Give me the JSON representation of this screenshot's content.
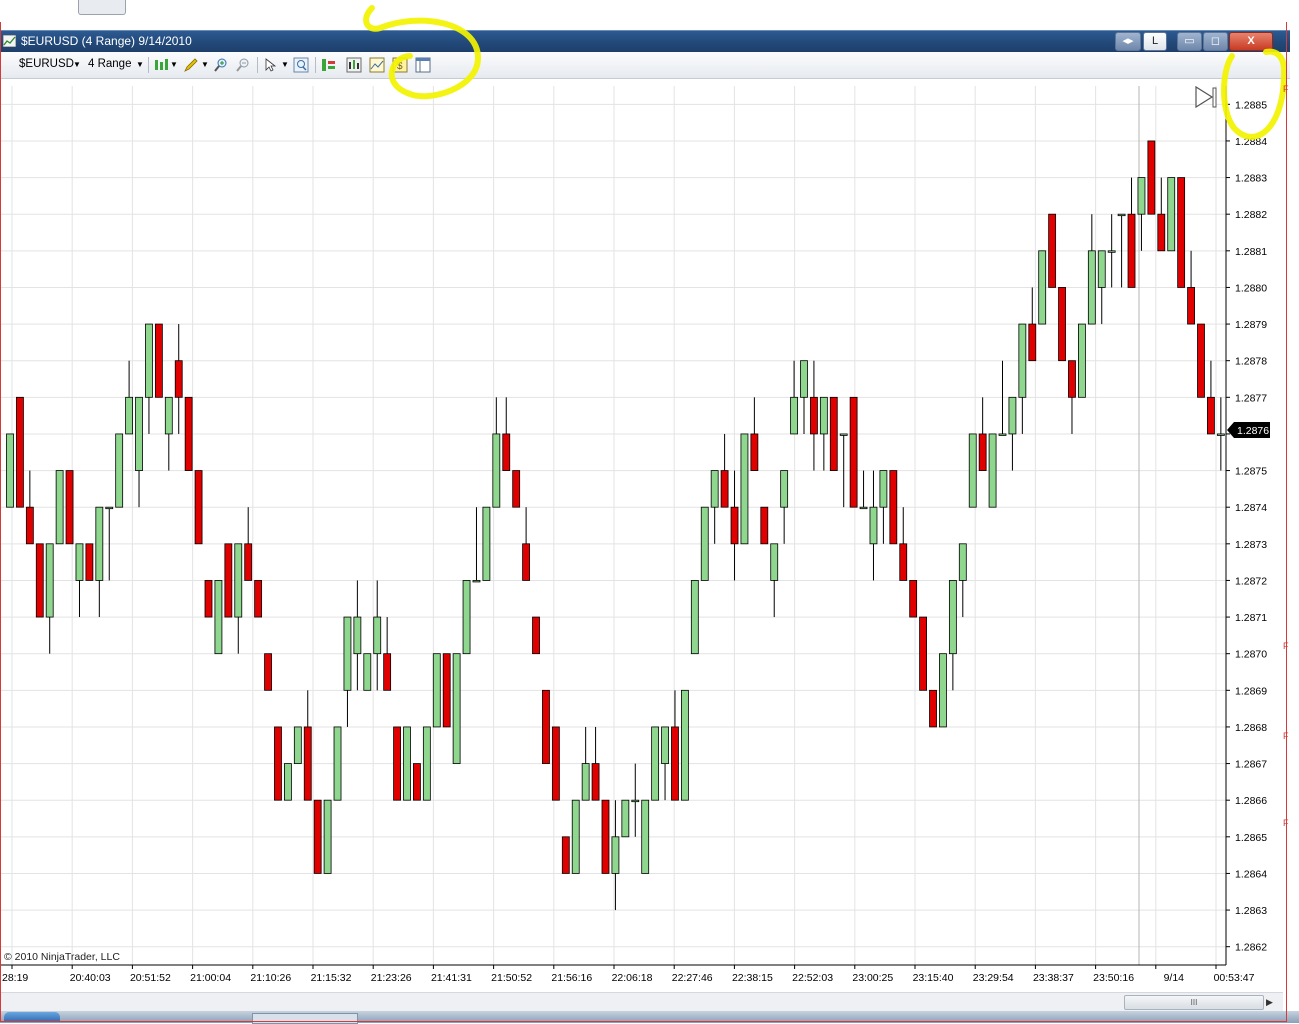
{
  "window": {
    "title": "$EURUSD (4 Range)  9/14/2010",
    "buttons": {
      "link": "L",
      "minimize": "▭",
      "maximize": "◻",
      "close": "X"
    }
  },
  "toolbar": {
    "instrument": "$EURUSD",
    "interval": "4 Range",
    "icons": [
      "bar-style-icon",
      "drawing-pencil-icon",
      "zoom-in-icon",
      "zoom-out-icon",
      "cursor-icon",
      "magnifier-icon",
      "chart-trader-icon",
      "indicators-icon",
      "strategies-icon",
      "properties-icon",
      "data-box-icon"
    ]
  },
  "colors": {
    "up_candle": "#8fd68f",
    "down_candle": "#e00000",
    "grid": "#e3e3e3",
    "highlight": "#f3f300",
    "price_marker_bg": "#000000"
  },
  "copyright": "© 2010 NinjaTrader, LLC",
  "scrollbar": {
    "thumb_label": "III"
  },
  "chart_data": {
    "type": "candlestick",
    "y_ticks": [
      "1.2885",
      "1.2884",
      "1.2883",
      "1.2882",
      "1.2881",
      "1.2880",
      "1.2879",
      "1.2878",
      "1.2877",
      "1.2876",
      "1.2875",
      "1.2874",
      "1.2873",
      "1.2872",
      "1.2871",
      "1.2870",
      "1.2869",
      "1.2868",
      "1.2867",
      "1.2866",
      "1.2865",
      "1.2864",
      "1.2863",
      "1.2862"
    ],
    "ylim": [
      1.28615,
      1.28855
    ],
    "current_price": "1.2876",
    "x_tick_labels": [
      "28:19",
      "20:40:03",
      "20:51:52",
      "21:00:04",
      "21:10:26",
      "21:15:32",
      "21:23:26",
      "21:41:31",
      "21:50:52",
      "21:56:16",
      "22:06:18",
      "22:27:46",
      "22:38:15",
      "22:52:03",
      "23:00:25",
      "23:15:40",
      "23:29:54",
      "23:38:37",
      "23:50:16",
      "9/14",
      "00:53:47"
    ],
    "candles": [
      [
        1.2874,
        1.2876,
        1.2874,
        1.2876
      ],
      [
        1.2877,
        1.2877,
        1.2874,
        1.2874
      ],
      [
        1.2874,
        1.2875,
        1.2873,
        1.2873
      ],
      [
        1.2873,
        1.2873,
        1.2871,
        1.2871
      ],
      [
        1.2871,
        1.2873,
        1.287,
        1.2873
      ],
      [
        1.2873,
        1.2875,
        1.2873,
        1.2875
      ],
      [
        1.2875,
        1.2875,
        1.2873,
        1.2873
      ],
      [
        1.2872,
        1.2873,
        1.2871,
        1.2873
      ],
      [
        1.2873,
        1.2873,
        1.2872,
        1.2872
      ],
      [
        1.2872,
        1.2874,
        1.2871,
        1.2874
      ],
      [
        1.2874,
        1.2874,
        1.2872,
        1.2874
      ],
      [
        1.2874,
        1.2876,
        1.2874,
        1.2876
      ],
      [
        1.2876,
        1.2878,
        1.2876,
        1.2877
      ],
      [
        1.2875,
        1.2877,
        1.2874,
        1.2877
      ],
      [
        1.2877,
        1.2879,
        1.2876,
        1.2879
      ],
      [
        1.2879,
        1.2879,
        1.2877,
        1.2877
      ],
      [
        1.2876,
        1.2877,
        1.2875,
        1.2877
      ],
      [
        1.2878,
        1.2879,
        1.2876,
        1.2877
      ],
      [
        1.2877,
        1.2877,
        1.2875,
        1.2875
      ],
      [
        1.2875,
        1.2875,
        1.2873,
        1.2873
      ],
      [
        1.2872,
        1.2872,
        1.2871,
        1.2871
      ],
      [
        1.287,
        1.2872,
        1.287,
        1.2872
      ],
      [
        1.2873,
        1.2873,
        1.2871,
        1.2871
      ],
      [
        1.2871,
        1.2873,
        1.287,
        1.2873
      ],
      [
        1.2873,
        1.2874,
        1.2872,
        1.2872
      ],
      [
        1.2872,
        1.2872,
        1.2871,
        1.2871
      ],
      [
        1.287,
        1.287,
        1.2869,
        1.2869
      ],
      [
        1.2868,
        1.2868,
        1.2867,
        1.2866
      ],
      [
        1.2866,
        1.2867,
        1.2866,
        1.2867
      ],
      [
        1.2867,
        1.2868,
        1.2867,
        1.2868
      ],
      [
        1.2868,
        1.2869,
        1.2867,
        1.2866
      ],
      [
        1.2866,
        1.2866,
        1.2865,
        1.2864
      ],
      [
        1.2864,
        1.2866,
        1.2864,
        1.2866
      ],
      [
        1.2866,
        1.2868,
        1.2866,
        1.2868
      ],
      [
        1.2869,
        1.2871,
        1.2868,
        1.2871
      ],
      [
        1.287,
        1.2872,
        1.2869,
        1.2871
      ],
      [
        1.2869,
        1.287,
        1.2869,
        1.287
      ],
      [
        1.287,
        1.2872,
        1.2869,
        1.2871
      ],
      [
        1.287,
        1.2871,
        1.2869,
        1.2869
      ],
      [
        1.2868,
        1.2868,
        1.2867,
        1.2866
      ],
      [
        1.2866,
        1.2868,
        1.2866,
        1.2868
      ],
      [
        1.2867,
        1.2867,
        1.2866,
        1.2866
      ],
      [
        1.2866,
        1.2868,
        1.2866,
        1.2868
      ],
      [
        1.2868,
        1.287,
        1.2868,
        1.287
      ],
      [
        1.287,
        1.287,
        1.2868,
        1.2868
      ],
      [
        1.2867,
        1.287,
        1.2867,
        1.287
      ],
      [
        1.287,
        1.2872,
        1.287,
        1.2872
      ],
      [
        1.2872,
        1.2874,
        1.2872,
        1.2872
      ],
      [
        1.2872,
        1.2874,
        1.2872,
        1.2874
      ],
      [
        1.2874,
        1.2877,
        1.2874,
        1.2876
      ],
      [
        1.2876,
        1.2877,
        1.2875,
        1.2875
      ],
      [
        1.2875,
        1.2875,
        1.2874,
        1.2874
      ],
      [
        1.2873,
        1.2874,
        1.2872,
        1.2872
      ],
      [
        1.2871,
        1.2871,
        1.287,
        1.287
      ],
      [
        1.2869,
        1.2869,
        1.2868,
        1.2867
      ],
      [
        1.2868,
        1.2868,
        1.2866,
        1.2866
      ],
      [
        1.2865,
        1.2865,
        1.2864,
        1.2864
      ],
      [
        1.2864,
        1.2866,
        1.2864,
        1.2866
      ],
      [
        1.2866,
        1.2868,
        1.2866,
        1.2867
      ],
      [
        1.2867,
        1.2868,
        1.2866,
        1.2866
      ],
      [
        1.2866,
        1.2866,
        1.2864,
        1.2864
      ],
      [
        1.2864,
        1.2866,
        1.2863,
        1.2865
      ],
      [
        1.2865,
        1.2866,
        1.2865,
        1.2866
      ],
      [
        1.2866,
        1.2867,
        1.2865,
        1.2866
      ],
      [
        1.2864,
        1.2866,
        1.2864,
        1.2866
      ],
      [
        1.2866,
        1.2868,
        1.2866,
        1.2868
      ],
      [
        1.2867,
        1.2868,
        1.2866,
        1.2868
      ],
      [
        1.2868,
        1.2869,
        1.2866,
        1.2866
      ],
      [
        1.2866,
        1.2869,
        1.2866,
        1.2869
      ],
      [
        1.287,
        1.2872,
        1.287,
        1.2872
      ],
      [
        1.2872,
        1.2874,
        1.2872,
        1.2874
      ],
      [
        1.2874,
        1.2875,
        1.2873,
        1.2875
      ],
      [
        1.2875,
        1.2876,
        1.2874,
        1.2874
      ],
      [
        1.2874,
        1.2875,
        1.2872,
        1.2873
      ],
      [
        1.2873,
        1.2876,
        1.2873,
        1.2876
      ],
      [
        1.2876,
        1.2877,
        1.2875,
        1.2875
      ],
      [
        1.2874,
        1.2874,
        1.2873,
        1.2873
      ],
      [
        1.2872,
        1.2873,
        1.2871,
        1.2873
      ],
      [
        1.2874,
        1.2875,
        1.2873,
        1.2875
      ],
      [
        1.2876,
        1.2878,
        1.2876,
        1.2877
      ],
      [
        1.2877,
        1.2878,
        1.2876,
        1.2878
      ],
      [
        1.2877,
        1.2878,
        1.2875,
        1.2876
      ],
      [
        1.2876,
        1.2877,
        1.2875,
        1.2877
      ],
      [
        1.2877,
        1.2877,
        1.2875,
        1.2875
      ],
      [
        1.2876,
        1.2876,
        1.2874,
        1.2876
      ],
      [
        1.2877,
        1.2877,
        1.2875,
        1.2874
      ],
      [
        1.2874,
        1.2875,
        1.2874,
        1.2874
      ],
      [
        1.2873,
        1.2875,
        1.2872,
        1.2874
      ],
      [
        1.2874,
        1.2875,
        1.2873,
        1.2875
      ],
      [
        1.2875,
        1.2875,
        1.2873,
        1.2873
      ],
      [
        1.2873,
        1.2874,
        1.2872,
        1.2872
      ],
      [
        1.2872,
        1.2872,
        1.2871,
        1.2871
      ],
      [
        1.2871,
        1.2871,
        1.2869,
        1.2869
      ],
      [
        1.2869,
        1.2869,
        1.2868,
        1.2868
      ],
      [
        1.2868,
        1.287,
        1.2868,
        1.287
      ],
      [
        1.287,
        1.2871,
        1.2869,
        1.2872
      ],
      [
        1.2872,
        1.2873,
        1.2871,
        1.2873
      ],
      [
        1.2874,
        1.2876,
        1.2874,
        1.2876
      ],
      [
        1.2876,
        1.2877,
        1.2875,
        1.2875
      ],
      [
        1.2874,
        1.2876,
        1.2874,
        1.2876
      ],
      [
        1.2876,
        1.2878,
        1.2876,
        1.2876
      ],
      [
        1.2876,
        1.2877,
        1.2875,
        1.2877
      ],
      [
        1.2877,
        1.2878,
        1.2876,
        1.2879
      ],
      [
        1.2879,
        1.288,
        1.2878,
        1.2878
      ],
      [
        1.2879,
        1.288,
        1.2879,
        1.2881
      ],
      [
        1.2882,
        1.2882,
        1.288,
        1.288
      ],
      [
        1.288,
        1.288,
        1.2878,
        1.2878
      ],
      [
        1.2878,
        1.2878,
        1.2876,
        1.2877
      ],
      [
        1.2877,
        1.2879,
        1.2877,
        1.2879
      ],
      [
        1.2879,
        1.2882,
        1.2879,
        1.2881
      ],
      [
        1.288,
        1.2881,
        1.2879,
        1.2881
      ],
      [
        1.2881,
        1.2882,
        1.288,
        1.2881
      ],
      [
        1.2882,
        1.2882,
        1.288,
        1.2882
      ],
      [
        1.2882,
        1.2883,
        1.2881,
        1.288
      ],
      [
        1.2882,
        1.2883,
        1.2881,
        1.2883
      ],
      [
        1.2884,
        1.2884,
        1.2882,
        1.2882
      ],
      [
        1.2882,
        1.2883,
        1.2881,
        1.2881
      ],
      [
        1.2881,
        1.2883,
        1.2881,
        1.2883
      ],
      [
        1.2883,
        1.2883,
        1.288,
        1.288
      ],
      [
        1.288,
        1.2881,
        1.2879,
        1.2879
      ],
      [
        1.2879,
        1.2879,
        1.2877,
        1.2877
      ],
      [
        1.2877,
        1.2878,
        1.2876,
        1.2876
      ],
      [
        1.2876,
        1.2877,
        1.2875,
        1.2876
      ]
    ]
  }
}
